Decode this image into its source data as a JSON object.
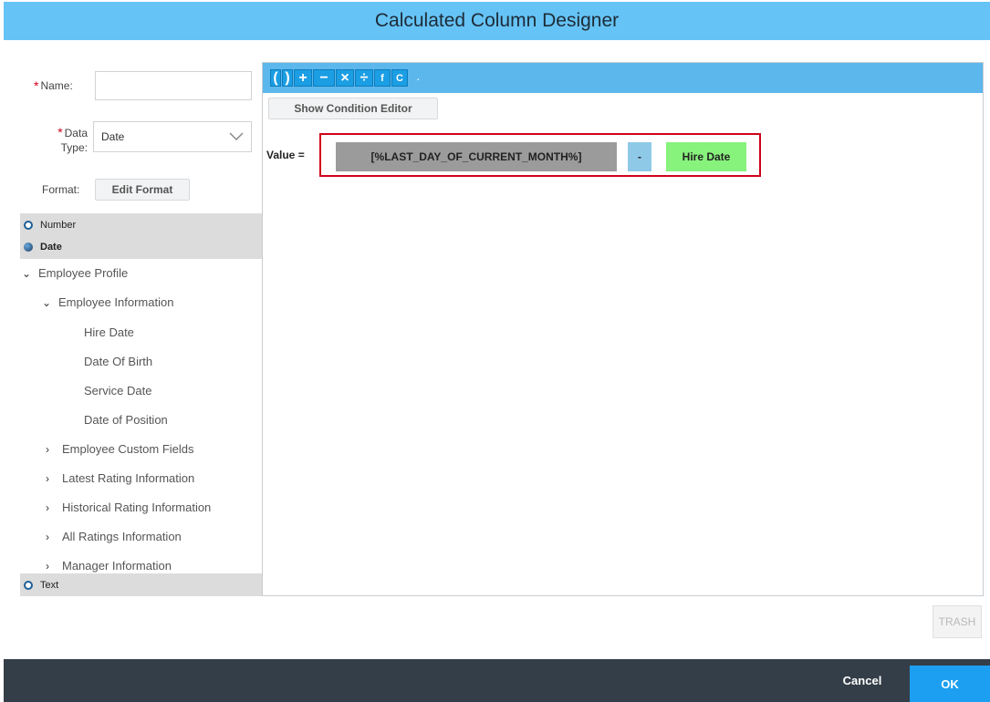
{
  "dialog": {
    "title": "Calculated Column Designer"
  },
  "form": {
    "name_label": "Name:",
    "name_value": "",
    "data_type_label_1": "Data",
    "data_type_label_2": "Type:",
    "data_type_value": "Date",
    "format_label": "Format:",
    "edit_format_button": "Edit Format"
  },
  "type_radios": {
    "number": "Number",
    "date": "Date",
    "text": "Text",
    "selected": "Date"
  },
  "tree": {
    "employee_profile": "Employee Profile",
    "employee_information": "Employee Information",
    "fields": [
      "Hire Date",
      "Date Of Birth",
      "Service Date",
      "Date of Position"
    ],
    "collapsed": [
      "Employee Custom Fields",
      "Latest Rating Information",
      "Historical Rating Information",
      "All Ratings Information",
      "Manager Information"
    ]
  },
  "editor": {
    "toolbar_buttons": [
      "(",
      ")",
      "+",
      "−",
      "×",
      "÷",
      "f",
      "C"
    ],
    "show_condition_button": "Show Condition Editor",
    "value_label": "Value =",
    "expression": {
      "variable": "[%LAST_DAY_OF_CURRENT_MONTH%]",
      "operator": "-",
      "field": "Hire Date"
    }
  },
  "actions": {
    "trash": "TRASH",
    "cancel": "Cancel",
    "ok": "OK"
  },
  "colors": {
    "title_bar": "#66c3f5",
    "toolbar": "#5cb7ec",
    "footer": "#343e48",
    "ok_button": "#1c9ff0",
    "expression_border": "#d0021b",
    "field_token": "#87f27c",
    "variable_token": "#9b9b9b",
    "operator_token": "#8fc9e8"
  }
}
